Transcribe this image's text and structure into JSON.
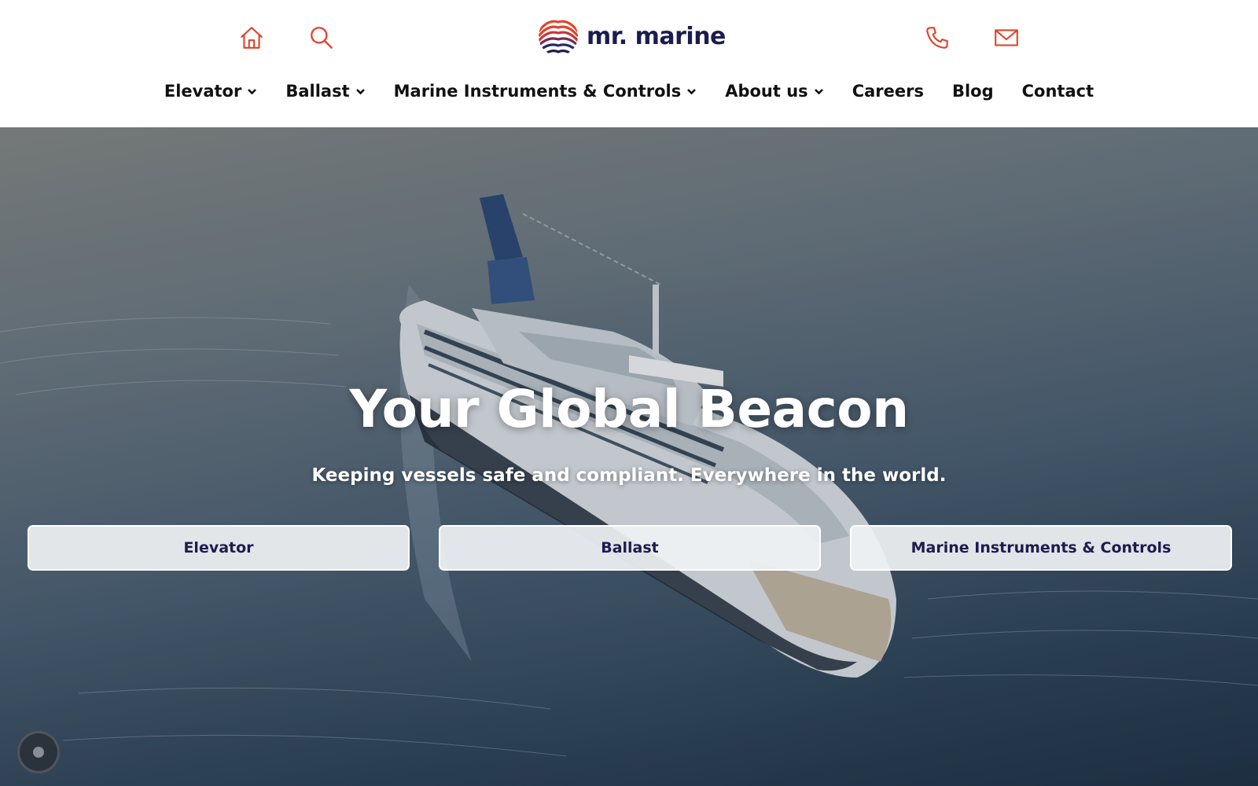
{
  "header": {
    "logo_text": "mr. marine",
    "icons": [
      "home-icon",
      "search-icon",
      "phone-icon",
      "mail-icon"
    ],
    "accent_color": "#e0442b",
    "brand_color": "#1c1c4e"
  },
  "nav": {
    "items": [
      {
        "label": "Elevator",
        "has_dropdown": true
      },
      {
        "label": "Ballast",
        "has_dropdown": true
      },
      {
        "label": "Marine Instruments & Controls",
        "has_dropdown": true
      },
      {
        "label": "About us",
        "has_dropdown": true
      },
      {
        "label": "Careers",
        "has_dropdown": false
      },
      {
        "label": "Blog",
        "has_dropdown": false
      },
      {
        "label": "Contact",
        "has_dropdown": false
      }
    ]
  },
  "hero": {
    "title": "Your Global Beacon",
    "subtitle": "Keeping vessels safe and compliant. Everywhere in the world.",
    "buttons": [
      {
        "label": "Elevator"
      },
      {
        "label": "Ballast"
      },
      {
        "label": "Marine Instruments & Controls"
      }
    ]
  },
  "widgets": {
    "chat_icon": "chat-icon"
  }
}
